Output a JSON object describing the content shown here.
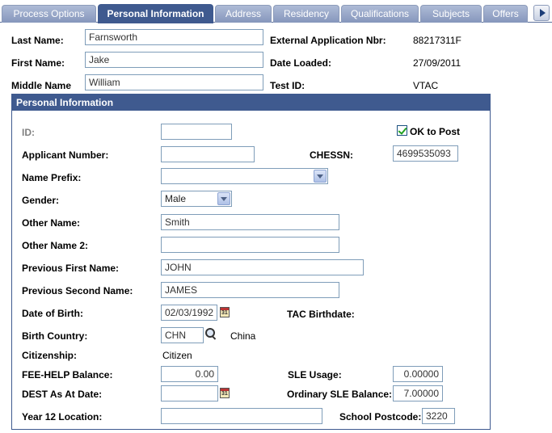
{
  "tabs": [
    {
      "label": "Process Options",
      "active": false
    },
    {
      "label": "Personal Information",
      "active": true
    },
    {
      "label": "Address",
      "active": false
    },
    {
      "label": "Residency",
      "active": false
    },
    {
      "label": "Qualifications",
      "active": false
    },
    {
      "label": "Subjects",
      "active": false
    },
    {
      "label": "Offers",
      "active": false
    }
  ],
  "header": {
    "last_name_label": "Last Name:",
    "last_name": "Farnsworth",
    "first_name_label": "First Name:",
    "first_name": "Jake",
    "middle_name_label": "Middle Name",
    "middle_name": "William",
    "ext_app_label": "External Application Nbr:",
    "ext_app": "88217311F",
    "date_loaded_label": "Date Loaded:",
    "date_loaded": "27/09/2011",
    "test_id_label": "Test ID:",
    "test_id": "VTAC"
  },
  "section": {
    "title": "Personal Information",
    "id_label": "ID:",
    "id_value": "",
    "ok_to_post_label": "OK to Post",
    "ok_to_post_checked": true,
    "applicant_number_label": "Applicant Number:",
    "applicant_number": "",
    "chessn_label": "CHESSN:",
    "chessn": "4699535093",
    "name_prefix_label": "Name Prefix:",
    "name_prefix": "",
    "gender_label": "Gender:",
    "gender": "Male",
    "other_name_label": "Other Name:",
    "other_name": "Smith",
    "other_name2_label": "Other Name 2:",
    "other_name2": "",
    "prev_first_label": "Previous First Name:",
    "prev_first": "JOHN",
    "prev_second_label": "Previous Second Name:",
    "prev_second": "JAMES",
    "dob_label": "Date of Birth:",
    "dob": "02/03/1992",
    "tac_birthdate_label": "TAC Birthdate:",
    "birth_country_label": "Birth Country:",
    "birth_country_code": "CHN",
    "birth_country_name": "China",
    "citizenship_label": "Citizenship:",
    "citizenship": "Citizen",
    "fee_help_label": "FEE-HELP Balance:",
    "fee_help": "0.00",
    "sle_usage_label": "SLE Usage:",
    "sle_usage": "0.00000",
    "dest_label": "DEST As At Date:",
    "dest": "",
    "ordinary_sle_label": "Ordinary SLE Balance:",
    "ordinary_sle": "7.00000",
    "year12_label": "Year 12 Location:",
    "year12": "",
    "school_postcode_label": "School Postcode:",
    "school_postcode": "3220"
  }
}
